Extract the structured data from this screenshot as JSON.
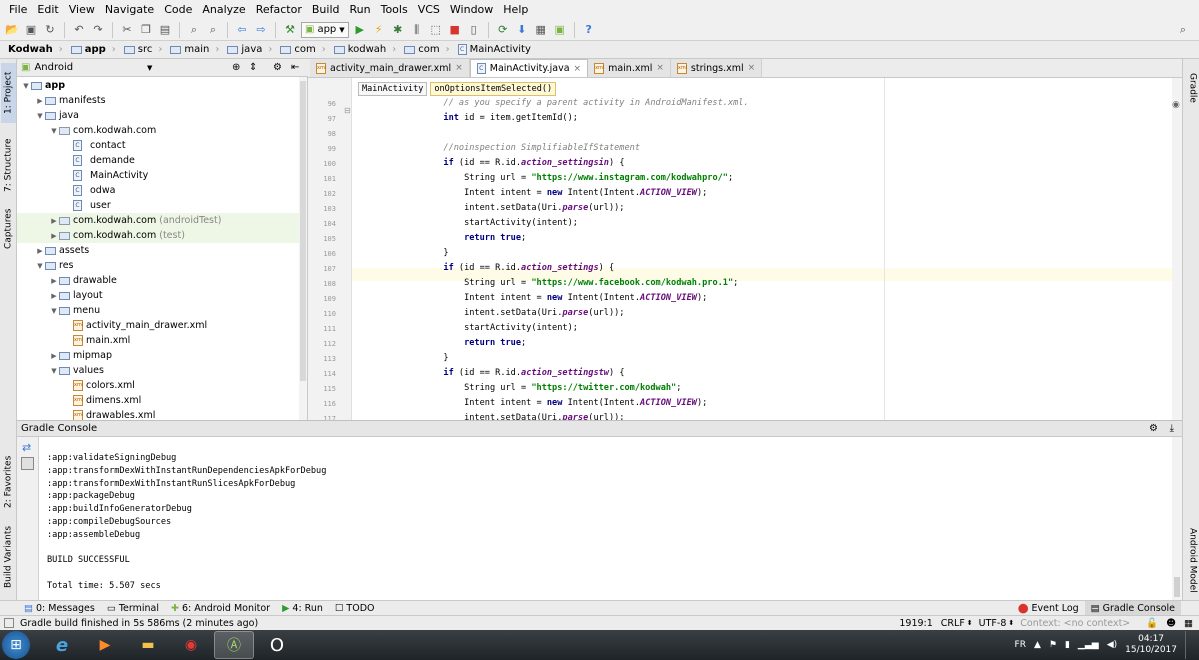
{
  "colors": {
    "accent": "#3c78d8",
    "active_tab": "#ffffff",
    "highlight_line": "#fefbe6",
    "keyword": "#000080",
    "string": "#008000",
    "comment": "#808080"
  },
  "menu": [
    "File",
    "Edit",
    "View",
    "Navigate",
    "Code",
    "Analyze",
    "Refactor",
    "Build",
    "Run",
    "Tools",
    "VCS",
    "Window",
    "Help"
  ],
  "toolbar": {
    "run_config": "app",
    "help": "?"
  },
  "breadcrumbs": [
    "Kodwah",
    "app",
    "src",
    "main",
    "java",
    "com",
    "kodwah",
    "com",
    "MainActivity"
  ],
  "left_tools": {
    "project": "1: Project",
    "structure": "7: Structure",
    "captures": "Captures",
    "favorites": "2: Favorites",
    "build_variants": "Build Variants"
  },
  "right_tools": {
    "gradle": "Gradle",
    "android_model": "Android Model"
  },
  "project": {
    "view_mode": "Android",
    "tree": [
      {
        "label": "app",
        "depth": 0,
        "kind": "folder",
        "expanded": true,
        "bold": true
      },
      {
        "label": "manifests",
        "depth": 1,
        "kind": "folder",
        "expanded": false
      },
      {
        "label": "java",
        "depth": 1,
        "kind": "folder",
        "expanded": true
      },
      {
        "label": "com.kodwah.com",
        "depth": 2,
        "kind": "package",
        "expanded": true
      },
      {
        "label": "contact",
        "depth": 3,
        "kind": "java"
      },
      {
        "label": "demande",
        "depth": 3,
        "kind": "java"
      },
      {
        "label": "MainActivity",
        "depth": 3,
        "kind": "java"
      },
      {
        "label": "odwa",
        "depth": 3,
        "kind": "java"
      },
      {
        "label": "user",
        "depth": 3,
        "kind": "java"
      },
      {
        "label": "com.kodwah.com",
        "suffix": "(androidTest)",
        "depth": 2,
        "kind": "package",
        "expanded": false,
        "tinted": true
      },
      {
        "label": "com.kodwah.com",
        "suffix": "(test)",
        "depth": 2,
        "kind": "package",
        "expanded": false,
        "tinted": true
      },
      {
        "label": "assets",
        "depth": 1,
        "kind": "folder",
        "expanded": false
      },
      {
        "label": "res",
        "depth": 1,
        "kind": "folder",
        "expanded": true
      },
      {
        "label": "drawable",
        "depth": 2,
        "kind": "folder",
        "expanded": false
      },
      {
        "label": "layout",
        "depth": 2,
        "kind": "folder",
        "expanded": false
      },
      {
        "label": "menu",
        "depth": 2,
        "kind": "folder",
        "expanded": true
      },
      {
        "label": "activity_main_drawer.xml",
        "depth": 3,
        "kind": "xml"
      },
      {
        "label": "main.xml",
        "depth": 3,
        "kind": "xml"
      },
      {
        "label": "mipmap",
        "depth": 2,
        "kind": "folder",
        "expanded": false
      },
      {
        "label": "values",
        "depth": 2,
        "kind": "folder",
        "expanded": true
      },
      {
        "label": "colors.xml",
        "depth": 3,
        "kind": "xml"
      },
      {
        "label": "dimens.xml",
        "depth": 3,
        "kind": "xml"
      },
      {
        "label": "drawables.xml",
        "depth": 3,
        "kind": "xml"
      }
    ]
  },
  "tabs": [
    {
      "label": "activity_main_drawer.xml",
      "kind": "xml",
      "active": false
    },
    {
      "label": "MainActivity.java",
      "kind": "java",
      "active": true
    },
    {
      "label": "main.xml",
      "kind": "xml",
      "active": false
    },
    {
      "label": "strings.xml",
      "kind": "xml",
      "active": false
    }
  ],
  "editor": {
    "breadcrumb": [
      "MainActivity",
      "onOptionsItemSelected()"
    ],
    "lines": [
      {
        "n": "96",
        "parts": [
          [
            "cmt",
            "        // as you specify a parent activity in AndroidManifest.xml."
          ]
        ]
      },
      {
        "n": "97",
        "parts": [
          [
            "kw",
            "        int "
          ],
          [
            "",
            "id = item.getItemId();"
          ]
        ]
      },
      {
        "n": "98",
        "parts": []
      },
      {
        "n": "99",
        "parts": [
          [
            "cmt",
            "        //noinspection SimplifiableIfStatement"
          ]
        ]
      },
      {
        "n": "100",
        "parts": [
          [
            "kw",
            "        if "
          ],
          [
            "",
            "(id == R.id."
          ],
          [
            "fld",
            "action_settingsin"
          ],
          [
            "",
            ") {"
          ]
        ]
      },
      {
        "n": "101",
        "parts": [
          [
            "",
            "            String url = "
          ],
          [
            "str",
            "\"https://www.instagram.com/kodwahpro/\""
          ],
          [
            "",
            ";"
          ]
        ]
      },
      {
        "n": "102",
        "parts": [
          [
            "",
            "            Intent intent = "
          ],
          [
            "kw",
            "new "
          ],
          [
            "",
            "Intent(Intent."
          ],
          [
            "fld",
            "ACTION_VIEW"
          ],
          [
            "",
            ");"
          ]
        ]
      },
      {
        "n": "103",
        "parts": [
          [
            "",
            "            intent.setData(Uri."
          ],
          [
            "fld",
            "parse"
          ],
          [
            "",
            "(url));"
          ]
        ]
      },
      {
        "n": "104",
        "parts": [
          [
            "",
            "            startActivity(intent);"
          ]
        ]
      },
      {
        "n": "105",
        "parts": [
          [
            "kw",
            "            return true"
          ],
          [
            "",
            ";"
          ]
        ]
      },
      {
        "n": "106",
        "parts": [
          [
            "",
            "        }"
          ]
        ]
      },
      {
        "n": "107",
        "parts": [
          [
            "kw",
            "        if "
          ],
          [
            "",
            "(id == R.id."
          ],
          [
            "fld",
            "action_settings"
          ],
          [
            "",
            ") {"
          ]
        ]
      },
      {
        "n": "108",
        "parts": [
          [
            "",
            "            String url = "
          ],
          [
            "str",
            "\"https://www.facebook.com/kodwah.pro.1\""
          ],
          [
            "",
            ";"
          ]
        ]
      },
      {
        "n": "109",
        "parts": [
          [
            "",
            "            Intent intent = "
          ],
          [
            "kw",
            "new "
          ],
          [
            "",
            "Intent(Intent."
          ],
          [
            "fld",
            "ACTION_VIEW"
          ],
          [
            "",
            ");"
          ]
        ]
      },
      {
        "n": "110",
        "parts": [
          [
            "",
            "            intent.setData(Uri."
          ],
          [
            "fld",
            "parse"
          ],
          [
            "",
            "(url));"
          ]
        ]
      },
      {
        "n": "111",
        "parts": [
          [
            "",
            "            startActivity(intent);"
          ]
        ]
      },
      {
        "n": "112",
        "parts": [
          [
            "kw",
            "            return true"
          ],
          [
            "",
            ";"
          ]
        ]
      },
      {
        "n": "113",
        "parts": [
          [
            "",
            "        }"
          ]
        ]
      },
      {
        "n": "114",
        "parts": [
          [
            "kw",
            "        if "
          ],
          [
            "",
            "(id == R.id."
          ],
          [
            "fld",
            "action_settingstw"
          ],
          [
            "",
            ") {"
          ]
        ]
      },
      {
        "n": "115",
        "parts": [
          [
            "",
            "            String url = "
          ],
          [
            "str",
            "\"https://twitter.com/kodwah\""
          ],
          [
            "",
            ";"
          ]
        ]
      },
      {
        "n": "116",
        "parts": [
          [
            "",
            "            Intent intent = "
          ],
          [
            "kw",
            "new "
          ],
          [
            "",
            "Intent(Intent."
          ],
          [
            "fld",
            "ACTION_VIEW"
          ],
          [
            "",
            ");"
          ]
        ]
      },
      {
        "n": "117",
        "parts": [
          [
            "",
            "            intent.setData(Uri."
          ],
          [
            "fld",
            "parse"
          ],
          [
            "",
            "(url));"
          ]
        ]
      },
      {
        "n": "118",
        "parts": [
          [
            "",
            "            startActivity(intent);"
          ]
        ]
      },
      {
        "n": "119",
        "parts": [
          [
            "kw",
            "            return true"
          ],
          [
            "",
            ";"
          ]
        ]
      },
      {
        "n": "120",
        "parts": [
          [
            "",
            "        }"
          ]
        ]
      }
    ]
  },
  "gradle_console": {
    "title": "Gradle Console",
    "lines": [
      ":app:validateSigningDebug",
      ":app:transformDexWithInstantRunDependenciesApkForDebug",
      ":app:transformDexWithInstantRunSlicesApkForDebug",
      ":app:packageDebug",
      ":app:buildInfoGeneratorDebug",
      ":app:compileDebugSources",
      ":app:assembleDebug",
      "",
      "BUILD SUCCESSFUL",
      "",
      "Total time: 5.507 secs"
    ]
  },
  "bottom_tools": {
    "messages": "0: Messages",
    "terminal": "Terminal",
    "android_monitor": "6: Android Monitor",
    "run": "4: Run",
    "todo": "TODO",
    "event_log": "Event Log",
    "gradle_console": "Gradle Console"
  },
  "status": {
    "message": "Gradle build finished in 5s 586ms (2 minutes ago)",
    "position": "1919:1",
    "line_sep": "CRLF",
    "encoding": "UTF-8",
    "context_label": "Context:",
    "context_value": "<no context>"
  },
  "taskbar": {
    "lang": "FR",
    "time": "04:17",
    "date": "15/10/2017"
  }
}
